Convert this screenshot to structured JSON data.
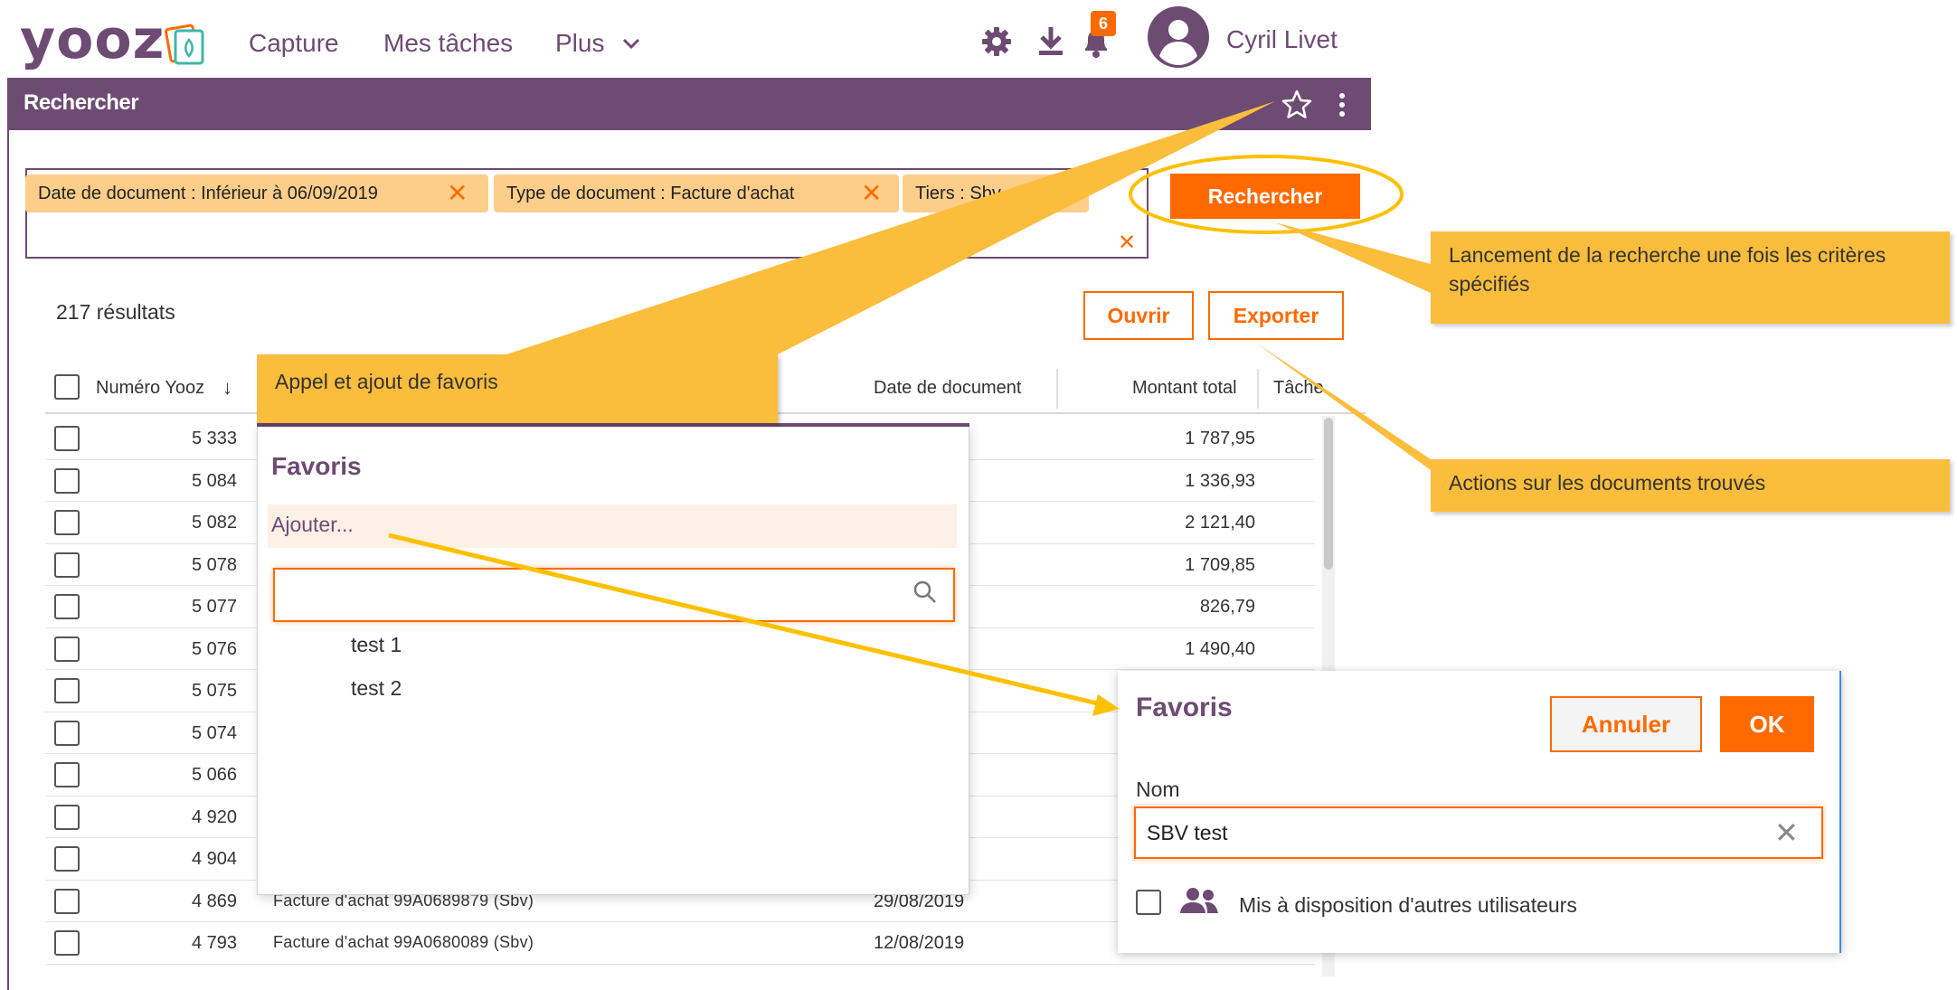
{
  "nav": {
    "logo": "yooz",
    "items": [
      "Capture",
      "Mes tâches",
      "Plus"
    ],
    "notification_count": "6",
    "user_name": "Cyril Livet"
  },
  "header": {
    "title": "Rechercher"
  },
  "filters": {
    "chips": [
      "Date de document : Inférieur à 06/09/2019",
      "Type de document : Facture d'achat",
      "Tiers : Sbv"
    ],
    "search_button": "Rechercher"
  },
  "results": {
    "count": "217 résultats",
    "open_button": "Ouvrir",
    "export_button": "Exporter",
    "columns": [
      "Numéro Yooz",
      "Date de document",
      "Montant total",
      "Tâche"
    ],
    "rows": [
      {
        "num": "5 333",
        "desc": "",
        "date": "",
        "amount": "1 787,95"
      },
      {
        "num": "5 084",
        "desc": "",
        "date": "",
        "amount": "1 336,93"
      },
      {
        "num": "5 082",
        "desc": "",
        "date": "",
        "amount": "2 121,40"
      },
      {
        "num": "5 078",
        "desc": "",
        "date": "",
        "amount": "1 709,85"
      },
      {
        "num": "5 077",
        "desc": "",
        "date": "",
        "amount": "826,79"
      },
      {
        "num": "5 076",
        "desc": "",
        "date": "",
        "amount": "1 490,40"
      },
      {
        "num": "5 075",
        "desc": "",
        "date": "",
        "amount": ""
      },
      {
        "num": "5 074",
        "desc": "",
        "date": "",
        "amount": ""
      },
      {
        "num": "5 066",
        "desc": "",
        "date": "",
        "amount": ""
      },
      {
        "num": "4 920",
        "desc": "",
        "date": "",
        "amount": ""
      },
      {
        "num": "4 904",
        "desc": "",
        "date": "",
        "amount": ""
      },
      {
        "num": "4 869",
        "desc": "Facture d'achat 99A0689879 (Sbv)",
        "date": "29/08/2019",
        "amount": ""
      },
      {
        "num": "4 793",
        "desc": "Facture d'achat 99A0680089 (Sbv)",
        "date": "12/08/2019",
        "amount": ""
      }
    ]
  },
  "favoris_dropdown": {
    "title": "Favoris",
    "add_label": "Ajouter...",
    "search_placeholder": "",
    "items": [
      "test 1",
      "test 2"
    ]
  },
  "favoris_modal": {
    "title": "Favoris",
    "cancel_button": "Annuler",
    "ok_button": "OK",
    "name_label": "Nom",
    "name_value": "SBV test",
    "share_label": "Mis à disposition d'autres utilisateurs"
  },
  "callouts": {
    "favoris": "Appel et ajout de favoris",
    "search": "Lancement de la recherche une fois les critères spécifiés",
    "actions": "Actions sur les documents trouvés"
  },
  "colors": {
    "brand_purple": "#6d4b73",
    "accent_orange": "#ff6a00",
    "chip_bg": "#fcce8a",
    "callout_bg": "#fbbd3c"
  }
}
